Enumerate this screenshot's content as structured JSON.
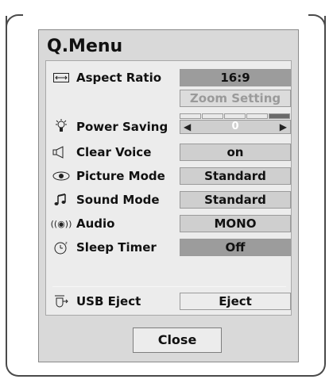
{
  "menu": {
    "title": "Q.Menu"
  },
  "items": [
    {
      "icon": "aspect-ratio-icon",
      "label": "Aspect Ratio",
      "value": "16:9"
    },
    {
      "sub_value": "Zoom Setting"
    },
    {
      "icon": "power-saving-icon",
      "label": "Power Saving",
      "value": "0",
      "level_fraction": 0.0
    },
    {
      "icon": "clear-voice-icon",
      "label": "Clear Voice",
      "value": "on"
    },
    {
      "icon": "picture-mode-icon",
      "label": "Picture Mode",
      "value": "Standard"
    },
    {
      "icon": "sound-mode-icon",
      "label": "Sound Mode",
      "value": "Standard"
    },
    {
      "icon": "audio-icon",
      "label": "Audio",
      "value": "MONO"
    },
    {
      "icon": "sleep-timer-icon",
      "label": "Sleep Timer",
      "value": "Off"
    },
    {
      "icon": "usb-eject-icon",
      "label": "USB Eject",
      "value": "Eject"
    }
  ],
  "close_label": "Close",
  "colors": {
    "panel": "#ececec",
    "frame": "#d9d9d9",
    "highlight": "#9c9c9c"
  }
}
